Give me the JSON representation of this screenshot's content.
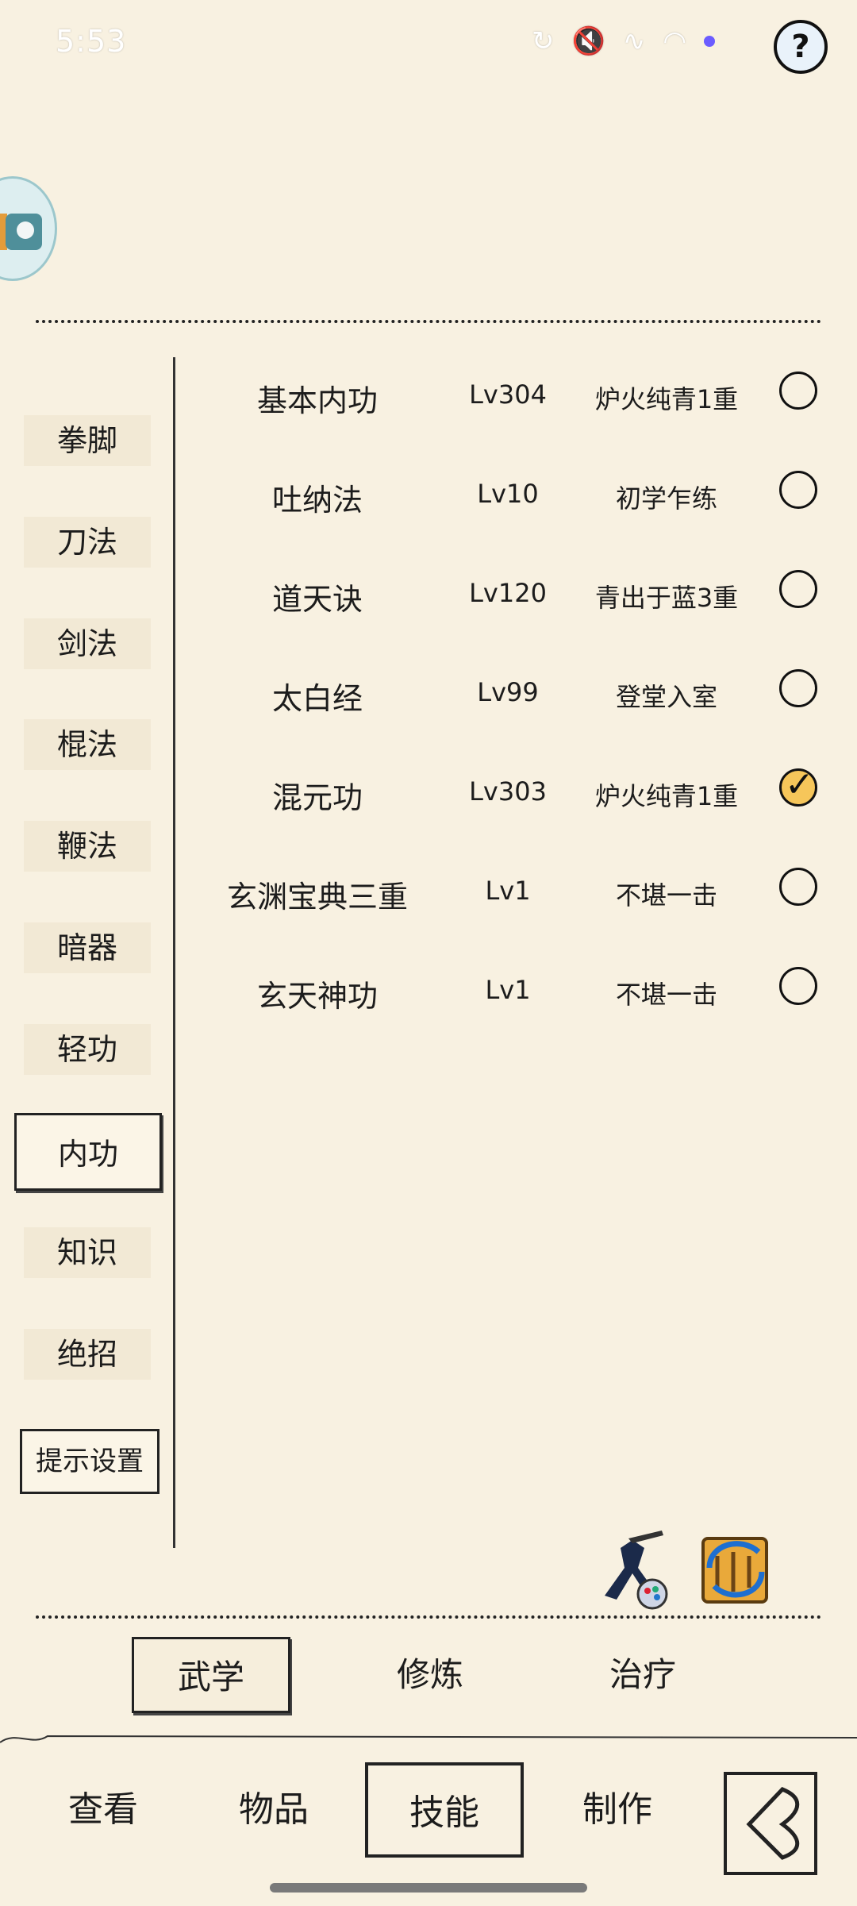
{
  "status_bar": {
    "time": "5:53",
    "icons": [
      "sync-icon",
      "mute-icon",
      "signal-icon",
      "wifi-icon",
      "dot-indicator"
    ],
    "help_icon": "?"
  },
  "sidebar": {
    "items": [
      {
        "label": "拳脚",
        "selected": false
      },
      {
        "label": "刀法",
        "selected": false
      },
      {
        "label": "剑法",
        "selected": false
      },
      {
        "label": "棍法",
        "selected": false
      },
      {
        "label": "鞭法",
        "selected": false
      },
      {
        "label": "暗器",
        "selected": false
      },
      {
        "label": "轻功",
        "selected": false
      },
      {
        "label": "内功",
        "selected": true
      },
      {
        "label": "知识",
        "selected": false
      },
      {
        "label": "绝招",
        "selected": false
      }
    ],
    "tip_settings_label": "提示设置"
  },
  "skills": [
    {
      "name": "基本内功",
      "level": "Lv304",
      "realm": "炉火纯青1重",
      "equipped": false
    },
    {
      "name": "吐纳法",
      "level": "Lv10",
      "realm": "初学乍练",
      "equipped": false
    },
    {
      "name": "道天诀",
      "level": "Lv120",
      "realm": "青出于蓝3重",
      "equipped": false
    },
    {
      "name": "太白经",
      "level": "Lv99",
      "realm": "登堂入室",
      "equipped": false
    },
    {
      "name": "混元功",
      "level": "Lv303",
      "realm": "炉火纯青1重",
      "equipped": true
    },
    {
      "name": "玄渊宝典三重",
      "level": "Lv1",
      "realm": "不堪一击",
      "equipped": false
    },
    {
      "name": "玄天神功",
      "level": "Lv1",
      "realm": "不堪一击",
      "equipped": false
    }
  ],
  "sub_tabs": [
    {
      "label": "武学",
      "selected": true
    },
    {
      "label": "修炼",
      "selected": false
    },
    {
      "label": "治疗",
      "selected": false
    }
  ],
  "bottom_nav": [
    {
      "label": "查看",
      "selected": false
    },
    {
      "label": "物品",
      "selected": false
    },
    {
      "label": "技能",
      "selected": true
    },
    {
      "label": "制作",
      "selected": false
    }
  ],
  "colors": {
    "background": "#f8f1e1",
    "ink": "#1c1c1c",
    "check_fill": "#f6c65a"
  }
}
